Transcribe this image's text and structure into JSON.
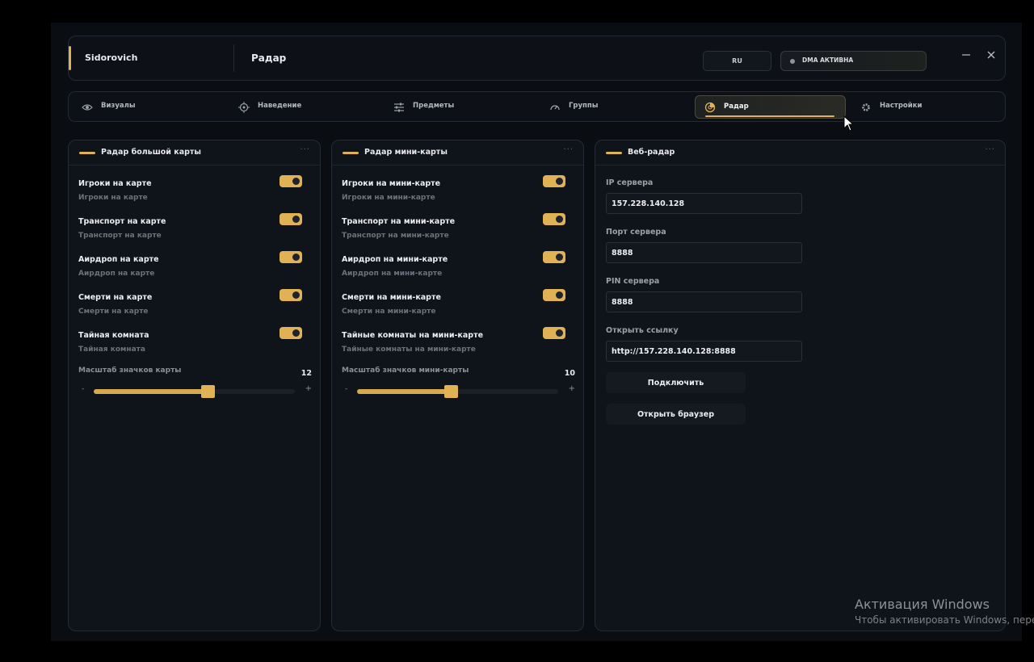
{
  "header": {
    "brand": "Sidorovich",
    "page_title": "Радар",
    "language": "RU",
    "dma_status": "DMA АКТИВНА",
    "minimize_icon": "minimize-icon",
    "close_icon": "close-icon"
  },
  "accent_color": "#e0b255",
  "tabs": [
    {
      "label": "Визуалы",
      "icon": "eye-icon"
    },
    {
      "label": "Наведение",
      "icon": "crosshair-icon"
    },
    {
      "label": "Предметы",
      "icon": "sliders-icon"
    },
    {
      "label": "Группы",
      "icon": "gauge-icon"
    },
    {
      "label": "Радар",
      "icon": "radar-icon",
      "active": true
    },
    {
      "label": "Настройки",
      "icon": "gear-icon"
    }
  ],
  "big_map_radar": {
    "title": "Радар большой карты",
    "options": [
      {
        "label": "Игроки на карте",
        "sub": "Игроки на карте",
        "on": true
      },
      {
        "label": "Транспорт на карте",
        "sub": "Транспорт на карте",
        "on": true
      },
      {
        "label": "Аирдроп на карте",
        "sub": "Аирдроп на карте",
        "on": true
      },
      {
        "label": "Смерти на карте",
        "sub": "Смерти на карте",
        "on": true
      },
      {
        "label": "Тайная комната",
        "sub": "Тайная комната",
        "on": true
      }
    ],
    "scale": {
      "label": "Масштаб значков карты",
      "value": "12",
      "minus": "-",
      "plus": "+",
      "fraction": 0.57
    }
  },
  "mini_map_radar": {
    "title": "Радар мини-карты",
    "options": [
      {
        "label": "Игроки на мини-карте",
        "sub": "Игроки на мини-карте",
        "on": true
      },
      {
        "label": "Транспорт на мини-карте",
        "sub": "Транспорт на мини-карте",
        "on": true
      },
      {
        "label": "Аирдроп на мини-карте",
        "sub": "Аирдроп на мини-карте",
        "on": true
      },
      {
        "label": "Смерти на мини-карте",
        "sub": "Смерти на мини-карте",
        "on": true
      },
      {
        "label": "Тайные комнаты на мини-карте",
        "sub": "Тайные комнаты на мини-карте",
        "on": true
      }
    ],
    "scale": {
      "label": "Масштаб значков мини-карты",
      "value": "10",
      "minus": "-",
      "plus": "+",
      "fraction": 0.47
    }
  },
  "web_radar": {
    "title": "Веб-радар",
    "server_ip_label": "IP сервера",
    "server_ip": "157.228.140.128",
    "server_port_label": "Порт сервера",
    "server_port": "8888",
    "server_pin_label": "PIN сервера",
    "server_pin": "8888",
    "open_link_label": "Открыть ссылку",
    "open_link": "http://157.228.140.128:8888",
    "connect_label": "Подключить",
    "open_browser_label": "Открыть браузер"
  },
  "more_glyph": "···",
  "windows_activation": {
    "title": "Активация Windows",
    "subtitle": "Чтобы активировать Windows, перейдите в раздел «Параметры»."
  }
}
